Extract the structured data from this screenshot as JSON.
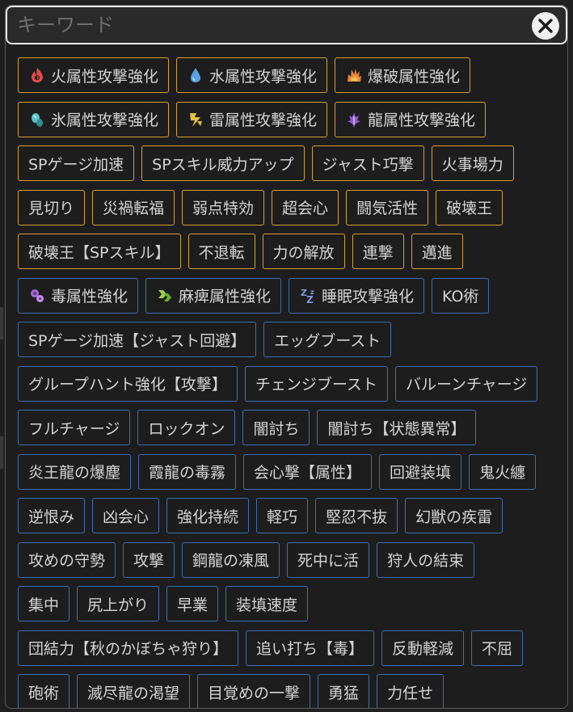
{
  "search": {
    "placeholder": "キーワード",
    "value": ""
  },
  "colors": {
    "accent_chip_border": "#d5a033",
    "secondary_chip_border": "#3e6fae",
    "background": "#1d1d1d",
    "text": "#d4d4d4"
  },
  "rows": [
    [
      {
        "label": "火属性攻撃強化",
        "icon": "fire-icon",
        "style": "gold"
      },
      {
        "label": "水属性攻撃強化",
        "icon": "water-drop-icon",
        "style": "gold"
      },
      {
        "label": "爆破属性強化",
        "icon": "blast-icon",
        "style": "gold"
      }
    ],
    [
      {
        "label": "氷属性攻撃強化",
        "icon": "ice-icon",
        "style": "gold"
      },
      {
        "label": "雷属性攻撃強化",
        "icon": "thunder-icon",
        "style": "gold"
      },
      {
        "label": "龍属性攻撃強化",
        "icon": "dragon-icon",
        "style": "gold"
      }
    ],
    [
      {
        "label": "SPゲージ加速",
        "style": "gold"
      },
      {
        "label": "SPスキル威力アップ",
        "style": "gold"
      },
      {
        "label": "ジャスト巧撃",
        "style": "gold"
      },
      {
        "label": "火事場力",
        "style": "gold"
      }
    ],
    [
      {
        "label": "見切り",
        "style": "gold"
      },
      {
        "label": "災禍転福",
        "style": "gold"
      },
      {
        "label": "弱点特効",
        "style": "gold"
      },
      {
        "label": "超会心",
        "style": "gold"
      },
      {
        "label": "闘気活性",
        "style": "gold"
      },
      {
        "label": "破壊王",
        "style": "gold"
      }
    ],
    [
      {
        "label": "破壊王【SPスキル】",
        "style": "gold"
      },
      {
        "label": "不退転",
        "style": "gold"
      },
      {
        "label": "力の解放",
        "style": "gold"
      },
      {
        "label": "連撃",
        "style": "gold"
      },
      {
        "label": "邁進",
        "style": "gold"
      }
    ],
    [
      {
        "label": "毒属性強化",
        "icon": "poison-icon",
        "style": "blue"
      },
      {
        "label": "麻痺属性強化",
        "icon": "paralysis-icon",
        "style": "blue"
      },
      {
        "label": "睡眠攻撃強化",
        "icon": "sleep-icon",
        "style": "blue"
      },
      {
        "label": "KO術",
        "style": "blue"
      }
    ],
    [
      {
        "label": "SPゲージ加速【ジャスト回避】",
        "style": "blue"
      },
      {
        "label": "エッグブースト",
        "style": "blue"
      }
    ],
    [
      {
        "label": "グループハント強化【攻撃】",
        "style": "blue"
      },
      {
        "label": "チェンジブースト",
        "style": "blue"
      },
      {
        "label": "バルーンチャージ",
        "style": "blue"
      }
    ],
    [
      {
        "label": "フルチャージ",
        "style": "blue"
      },
      {
        "label": "ロックオン",
        "style": "blue"
      },
      {
        "label": "闇討ち",
        "style": "blue"
      },
      {
        "label": "闇討ち【状態異常】",
        "style": "blue"
      }
    ],
    [
      {
        "label": "炎王龍の爆塵",
        "style": "blue"
      },
      {
        "label": "霞龍の毒霧",
        "style": "blue"
      },
      {
        "label": "会心撃【属性】",
        "style": "blue"
      },
      {
        "label": "回避装填",
        "style": "blue"
      },
      {
        "label": "鬼火纏",
        "style": "blue"
      }
    ],
    [
      {
        "label": "逆恨み",
        "style": "blue"
      },
      {
        "label": "凶会心",
        "style": "blue"
      },
      {
        "label": "強化持続",
        "style": "blue"
      },
      {
        "label": "軽巧",
        "style": "blue"
      },
      {
        "label": "堅忍不抜",
        "style": "blue"
      },
      {
        "label": "幻獣の疾雷",
        "style": "blue"
      }
    ],
    [
      {
        "label": "攻めの守勢",
        "style": "blue"
      },
      {
        "label": "攻撃",
        "style": "blue"
      },
      {
        "label": "鋼龍の凍風",
        "style": "blue"
      },
      {
        "label": "死中に活",
        "style": "blue"
      },
      {
        "label": "狩人の結束",
        "style": "blue"
      }
    ],
    [
      {
        "label": "集中",
        "style": "blue"
      },
      {
        "label": "尻上がり",
        "style": "blue"
      },
      {
        "label": "早業",
        "style": "blue"
      },
      {
        "label": "装填速度",
        "style": "blue"
      }
    ],
    [
      {
        "label": "団結力【秋のかぼちゃ狩り】",
        "style": "blue"
      },
      {
        "label": "追い打ち【毒】",
        "style": "blue"
      },
      {
        "label": "反動軽減",
        "style": "blue"
      },
      {
        "label": "不屈",
        "style": "blue"
      }
    ],
    [
      {
        "label": "砲術",
        "style": "blue"
      },
      {
        "label": "滅尽龍の渇望",
        "style": "blue"
      },
      {
        "label": "目覚めの一撃",
        "style": "blue"
      },
      {
        "label": "勇猛",
        "style": "blue"
      },
      {
        "label": "力任せ",
        "style": "blue"
      }
    ]
  ]
}
